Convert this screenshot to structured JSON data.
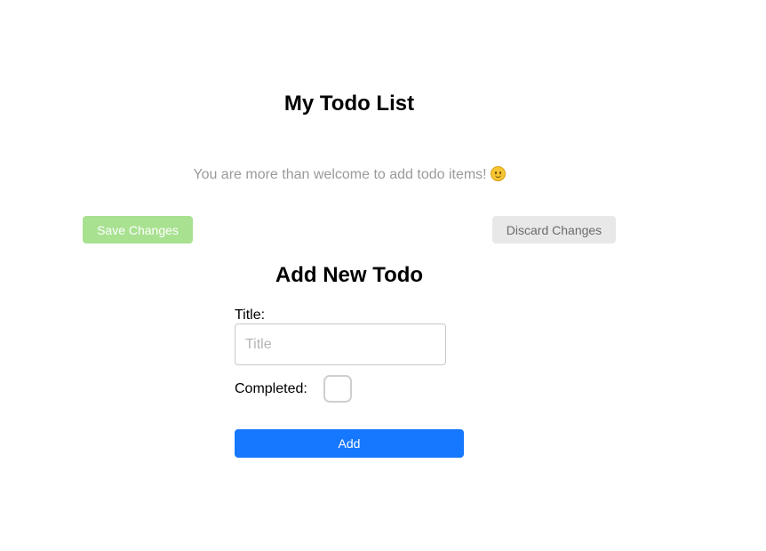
{
  "header": {
    "title": "My Todo List",
    "subtitle": "You are more than welcome to add todo items!"
  },
  "subtitle_icon": "smiling-face-emoji",
  "actions": {
    "save_label": "Save Changes",
    "discard_label": "Discard Changes"
  },
  "form": {
    "heading": "Add New Todo",
    "title_label": "Title:",
    "title_value": "",
    "title_placeholder": "Title",
    "completed_label": "Completed:",
    "completed_checked": false,
    "add_label": "Add"
  },
  "colors": {
    "save_button": "#a8e190",
    "discard_button": "#e8e8e8",
    "add_button": "#1677ff",
    "subtitle_text": "#9a9a9a"
  }
}
